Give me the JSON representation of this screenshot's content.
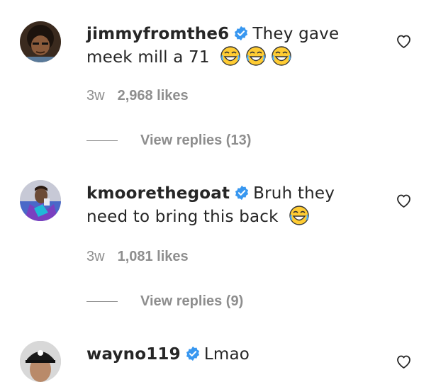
{
  "comments": [
    {
      "username": "jimmyfromthe6",
      "text": "They gave meek mill a 71",
      "emojis": [
        "laughing-crying-emoji",
        "laughing-crying-emoji",
        "laughing-crying-emoji"
      ],
      "time": "3w",
      "likes": "2,968 likes",
      "replies": "View replies (13)"
    },
    {
      "username": "kmoorethegoat",
      "text": "Bruh they need to bring this back",
      "emojis": [
        "laughing-crying-emoji"
      ],
      "time": "3w",
      "likes": "1,081 likes",
      "replies": "View replies (9)"
    },
    {
      "username": "wayno119",
      "text": "Lmao",
      "emojis": []
    }
  ],
  "colors": {
    "primary_text": "#262626",
    "secondary_text": "#8e8e8e",
    "verified_badge": "#3897f0",
    "emoji_face": "#ffcc33"
  }
}
